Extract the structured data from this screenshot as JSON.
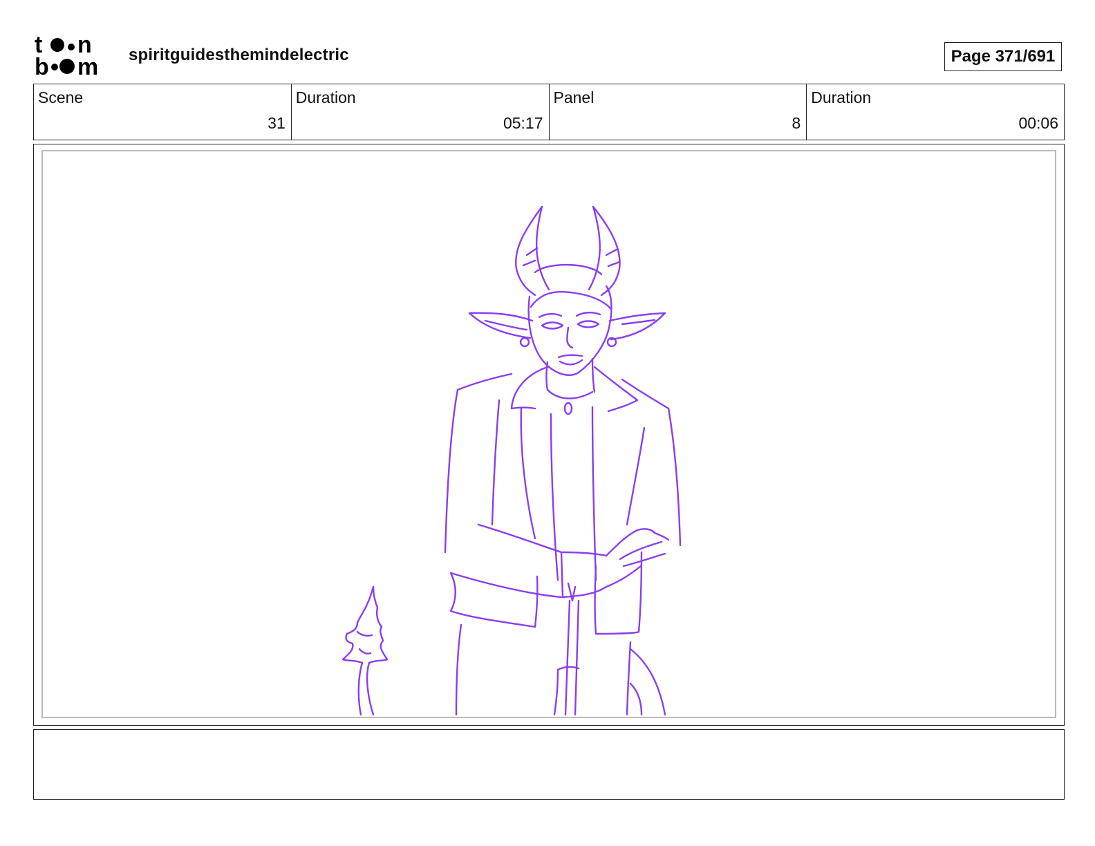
{
  "header": {
    "logo_text": "toon boom",
    "project_title": "spiritguidesthemindelectric",
    "page_label": "Page 371/691"
  },
  "info": {
    "scene_label": "Scene",
    "scene_value": "31",
    "scene_duration_label": "Duration",
    "scene_duration_value": "05:17",
    "panel_label": "Panel",
    "panel_value": "8",
    "panel_duration_label": "Duration",
    "panel_duration_value": "00:06"
  },
  "drawing": {
    "subject": "horned-demon-character-sketch",
    "stroke_color": "#8a3df0",
    "frame_color": "#b9b9b9"
  },
  "notes": {
    "text": ""
  }
}
